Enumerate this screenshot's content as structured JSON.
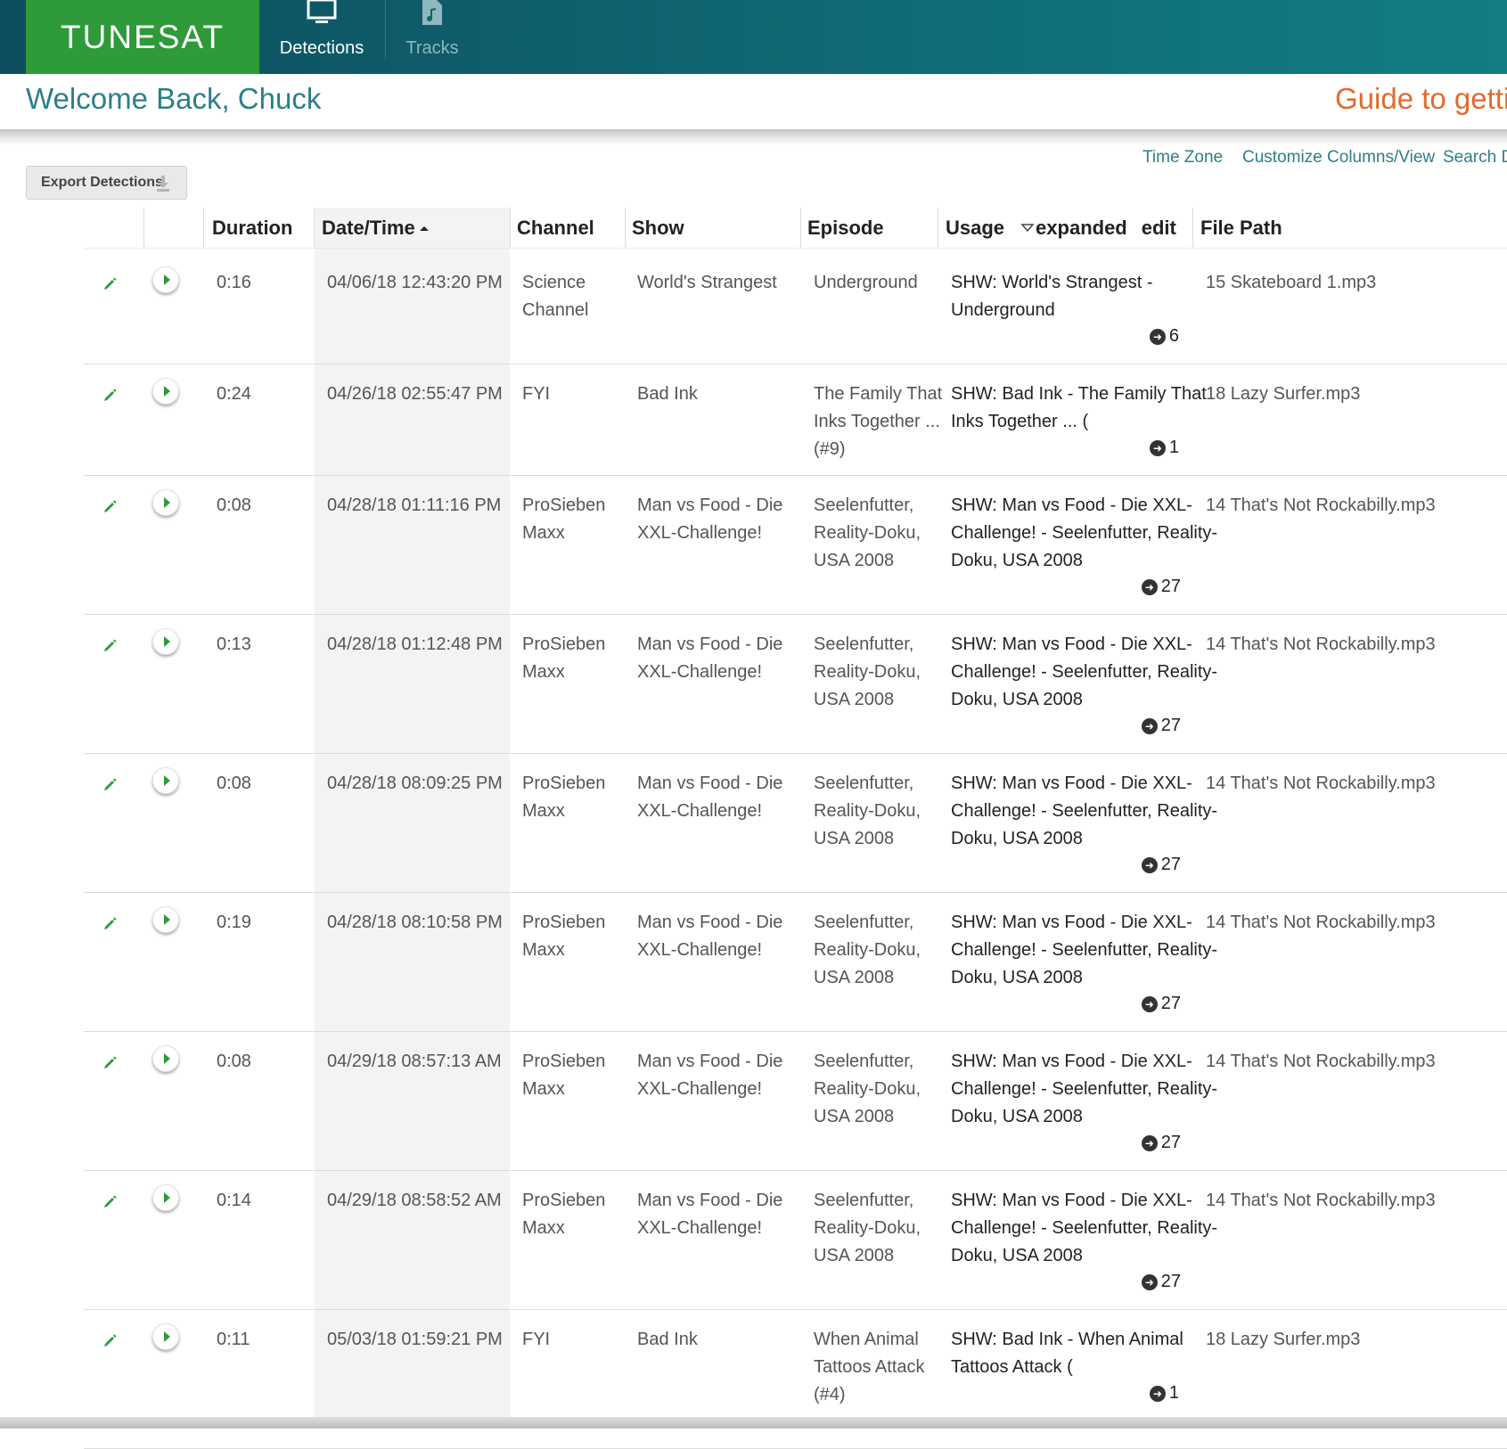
{
  "brand": {
    "logo_text": "TUNESAT"
  },
  "nav": {
    "tabs": [
      {
        "label": "Detections",
        "icon": "monitor-icon",
        "active": true
      },
      {
        "label": "Tracks",
        "icon": "music-file-icon",
        "active": false
      }
    ]
  },
  "header": {
    "welcome": "Welcome Back, Chuck",
    "guide_link": "Guide to getting"
  },
  "toolbar": {
    "time_zone": "Time Zone",
    "customize": "Customize Columns/View",
    "search": "Search De",
    "export_label": "Export Detections"
  },
  "table": {
    "columns": {
      "duration": "Duration",
      "datetime": "Date/Time",
      "channel": "Channel",
      "show": "Show",
      "episode": "Episode",
      "usage": "Usage",
      "usage_expanded": "expanded",
      "usage_edit": "edit",
      "filepath": "File Path"
    },
    "rows": [
      {
        "duration": "0:16",
        "datetime": "04/06/18 12:43:20 PM",
        "channel": [
          "Science",
          "Channel"
        ],
        "show": [
          "World's Strangest"
        ],
        "episode": [
          "Underground"
        ],
        "usage": [
          "SHW: World's Strangest -",
          "Underground"
        ],
        "count": "6",
        "filepath": "15 Skateboard 1.mp3"
      },
      {
        "duration": "0:24",
        "datetime": "04/26/18 02:55:47 PM",
        "channel": [
          "FYI"
        ],
        "show": [
          "Bad Ink"
        ],
        "episode": [
          "The Family That",
          "Inks Together ...",
          "(#9)"
        ],
        "usage": [
          "SHW: Bad Ink - The Family That",
          "Inks Together ... ("
        ],
        "count": "1",
        "filepath": "18 Lazy Surfer.mp3"
      },
      {
        "duration": "0:08",
        "datetime": "04/28/18 01:11:16 PM",
        "channel": [
          "ProSieben",
          "Maxx"
        ],
        "show": [
          "Man vs Food - Die",
          "XXL-Challenge!"
        ],
        "episode": [
          "Seelenfutter,",
          "Reality-Doku,",
          "USA 2008"
        ],
        "usage": [
          "SHW: Man vs Food - Die XXL-",
          "Challenge! - Seelenfutter, Reality-",
          "Doku, USA 2008"
        ],
        "count": "27",
        "filepath": "14 That's Not Rockabilly.mp3"
      },
      {
        "duration": "0:13",
        "datetime": "04/28/18 01:12:48 PM",
        "channel": [
          "ProSieben",
          "Maxx"
        ],
        "show": [
          "Man vs Food - Die",
          "XXL-Challenge!"
        ],
        "episode": [
          "Seelenfutter,",
          "Reality-Doku,",
          "USA 2008"
        ],
        "usage": [
          "SHW: Man vs Food - Die XXL-",
          "Challenge! - Seelenfutter, Reality-",
          "Doku, USA 2008"
        ],
        "count": "27",
        "filepath": "14 That's Not Rockabilly.mp3"
      },
      {
        "duration": "0:08",
        "datetime": "04/28/18 08:09:25 PM",
        "channel": [
          "ProSieben",
          "Maxx"
        ],
        "show": [
          "Man vs Food - Die",
          "XXL-Challenge!"
        ],
        "episode": [
          "Seelenfutter,",
          "Reality-Doku,",
          "USA 2008"
        ],
        "usage": [
          "SHW: Man vs Food - Die XXL-",
          "Challenge! - Seelenfutter, Reality-",
          "Doku, USA 2008"
        ],
        "count": "27",
        "filepath": "14 That's Not Rockabilly.mp3"
      },
      {
        "duration": "0:19",
        "datetime": "04/28/18 08:10:58 PM",
        "channel": [
          "ProSieben",
          "Maxx"
        ],
        "show": [
          "Man vs Food - Die",
          "XXL-Challenge!"
        ],
        "episode": [
          "Seelenfutter,",
          "Reality-Doku,",
          "USA 2008"
        ],
        "usage": [
          "SHW: Man vs Food - Die XXL-",
          "Challenge! - Seelenfutter, Reality-",
          "Doku, USA 2008"
        ],
        "count": "27",
        "filepath": "14 That's Not Rockabilly.mp3"
      },
      {
        "duration": "0:08",
        "datetime": "04/29/18 08:57:13 AM",
        "channel": [
          "ProSieben",
          "Maxx"
        ],
        "show": [
          "Man vs Food - Die",
          "XXL-Challenge!"
        ],
        "episode": [
          "Seelenfutter,",
          "Reality-Doku,",
          "USA 2008"
        ],
        "usage": [
          "SHW: Man vs Food - Die XXL-",
          "Challenge! - Seelenfutter, Reality-",
          "Doku, USA 2008"
        ],
        "count": "27",
        "filepath": "14 That's Not Rockabilly.mp3"
      },
      {
        "duration": "0:14",
        "datetime": "04/29/18 08:58:52 AM",
        "channel": [
          "ProSieben",
          "Maxx"
        ],
        "show": [
          "Man vs Food - Die",
          "XXL-Challenge!"
        ],
        "episode": [
          "Seelenfutter,",
          "Reality-Doku,",
          "USA 2008"
        ],
        "usage": [
          "SHW: Man vs Food - Die XXL-",
          "Challenge! - Seelenfutter, Reality-",
          "Doku, USA 2008"
        ],
        "count": "27",
        "filepath": "14 That's Not Rockabilly.mp3"
      },
      {
        "duration": "0:11",
        "datetime": "05/03/18 01:59:21 PM",
        "channel": [
          "FYI"
        ],
        "show": [
          "Bad Ink"
        ],
        "episode": [
          "When Animal",
          "Tattoos Attack",
          "(#4)"
        ],
        "usage": [
          "SHW: Bad Ink - When Animal",
          "Tattoos Attack ("
        ],
        "count": "1",
        "filepath": "18 Lazy Surfer.mp3"
      }
    ]
  },
  "colors": {
    "brand_green": "#2e9a3a",
    "teal": "#2d7f86",
    "orange": "#e26a2c"
  }
}
